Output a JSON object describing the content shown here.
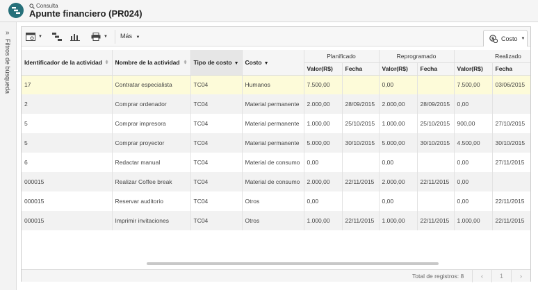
{
  "header": {
    "crumb": "Consulta",
    "title": "Apunte financiero (PR024)"
  },
  "sidebar": {
    "label": "Filtros de búsqueda"
  },
  "toolbar": {
    "more_label": "Más",
    "costo_tab": "Costo"
  },
  "table": {
    "groups": [
      "Planificado",
      "Reprogramado",
      "Realizado"
    ],
    "columns": {
      "id": "Identificador de la actividad",
      "name": "Nombre de la actividad",
      "tipo": "Tipo de costo",
      "costo": "Costo",
      "valor": "Valor(R$)",
      "fecha": "Fecha"
    },
    "rows": [
      {
        "id": "17",
        "name": "Contratar especialista",
        "tipo": "TC04",
        "costo": "Humanos",
        "pv": "7.500,00",
        "pf": "",
        "rv": "0,00",
        "rf": "",
        "ev": "7.500,00",
        "ef": "03/06/2015"
      },
      {
        "id": "2",
        "name": "Comprar ordenador",
        "tipo": "TC04",
        "costo": "Material permanente",
        "pv": "2.000,00",
        "pf": "28/09/2015",
        "rv": "2.000,00",
        "rf": "28/09/2015",
        "ev": "0,00",
        "ef": ""
      },
      {
        "id": "5",
        "name": "Comprar impresora",
        "tipo": "TC04",
        "costo": "Material permanente",
        "pv": "1.000,00",
        "pf": "25/10/2015",
        "rv": "1.000,00",
        "rf": "25/10/2015",
        "ev": "900,00",
        "ef": "27/10/2015"
      },
      {
        "id": "5",
        "name": "Comprar proyector",
        "tipo": "TC04",
        "costo": "Material permanente",
        "pv": "5.000,00",
        "pf": "30/10/2015",
        "rv": "5.000,00",
        "rf": "30/10/2015",
        "ev": "4.500,00",
        "ef": "30/10/2015"
      },
      {
        "id": "6",
        "name": "Redactar manual",
        "tipo": "TC04",
        "costo": "Material de consumo",
        "pv": "0,00",
        "pf": "",
        "rv": "0,00",
        "rf": "",
        "ev": "0,00",
        "ef": "27/11/2015"
      },
      {
        "id": "000015",
        "name": "Realizar Coffee break",
        "tipo": "TC04",
        "costo": "Material de consumo",
        "pv": "2.000,00",
        "pf": "22/11/2015",
        "rv": "2.000,00",
        "rf": "22/11/2015",
        "ev": "0,00",
        "ef": ""
      },
      {
        "id": "000015",
        "name": "Reservar auditorio",
        "tipo": "TC04",
        "costo": "Otros",
        "pv": "0,00",
        "pf": "",
        "rv": "0,00",
        "rf": "",
        "ev": "0,00",
        "ef": "22/11/2015"
      },
      {
        "id": "000015",
        "name": "Imprimir invitaciones",
        "tipo": "TC04",
        "costo": "Otros",
        "pv": "1.000,00",
        "pf": "22/11/2015",
        "rv": "1.000,00",
        "rf": "22/11/2015",
        "ev": "1.000,00",
        "ef": "22/11/2015"
      }
    ]
  },
  "footer": {
    "total": "Total de registros: 8",
    "page": "1",
    "prev": "‹",
    "next": "›"
  },
  "icons": {
    "logo": "app-logo-icon",
    "search": "search-icon",
    "expand": "double-chevron-right-icon",
    "view": "window-icon",
    "hierarchy": "hierarchy-icon",
    "chart": "bar-chart-icon",
    "print": "printer-icon",
    "cost": "money-icon"
  },
  "colors": {
    "logo": "#26707a",
    "selected_row": "#fdfbd9",
    "alt_row": "#f2f2f2"
  }
}
